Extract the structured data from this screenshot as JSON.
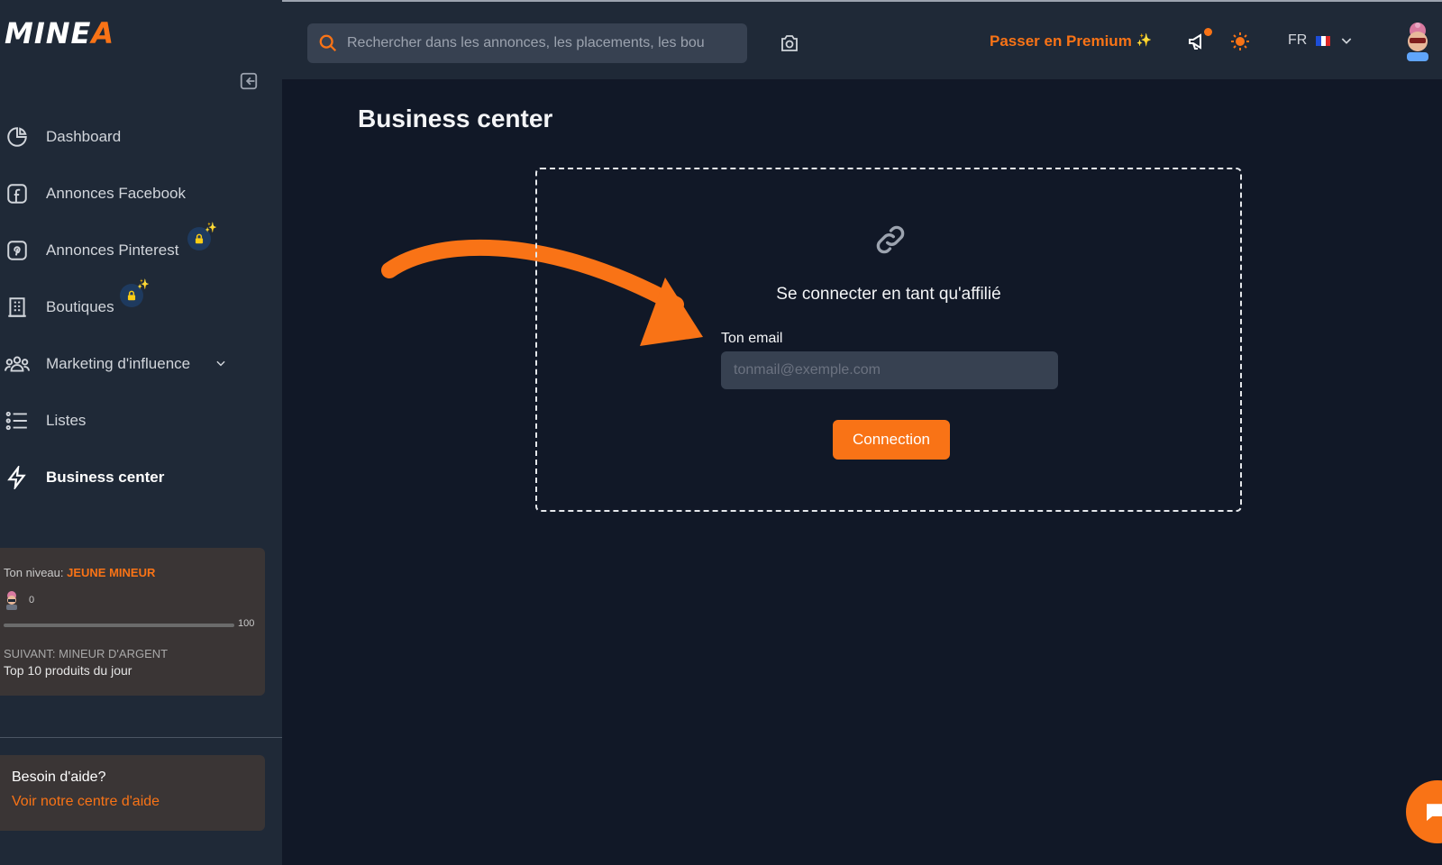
{
  "brand": {
    "logo_main": "MINE",
    "logo_accent": "A"
  },
  "sidebar": {
    "items": [
      {
        "label": "Dashboard",
        "icon": "pie-chart-icon"
      },
      {
        "label": "Annonces Facebook",
        "icon": "facebook-icon"
      },
      {
        "label": "Annonces Pinterest",
        "icon": "pinterest-icon",
        "locked": true
      },
      {
        "label": "Boutiques",
        "icon": "building-icon",
        "locked": true
      },
      {
        "label": "Marketing d'influence",
        "icon": "users-icon",
        "expandable": true
      },
      {
        "label": "Listes",
        "icon": "list-icon"
      },
      {
        "label": "Business center",
        "icon": "lightning-icon",
        "active": true
      }
    ],
    "level": {
      "prefix": "Ton niveau: ",
      "name": "JEUNE MINEUR",
      "xp": "0",
      "max": "100",
      "progress": 0,
      "next_label": "SUIVANT: MINEUR D'ARGENT",
      "next_reward": "Top 10 produits du jour"
    },
    "help": {
      "title": "Besoin d'aide?",
      "link": "Voir notre centre d'aide"
    }
  },
  "topbar": {
    "search_placeholder": "Rechercher dans les annonces, les placements, les bou",
    "premium_label": "Passer en Premium",
    "language": "FR",
    "flag_colors": [
      "#1d4ed8",
      "#ffffff",
      "#dc2626"
    ]
  },
  "main": {
    "title": "Business center",
    "connect": {
      "title": "Se connecter en tant qu'affilié",
      "email_label": "Ton email",
      "email_placeholder": "tonmail@exemple.com",
      "button": "Connection"
    }
  },
  "colors": {
    "accent": "#f97316",
    "sidebar_bg": "#1f2937",
    "page_bg": "#111827"
  }
}
